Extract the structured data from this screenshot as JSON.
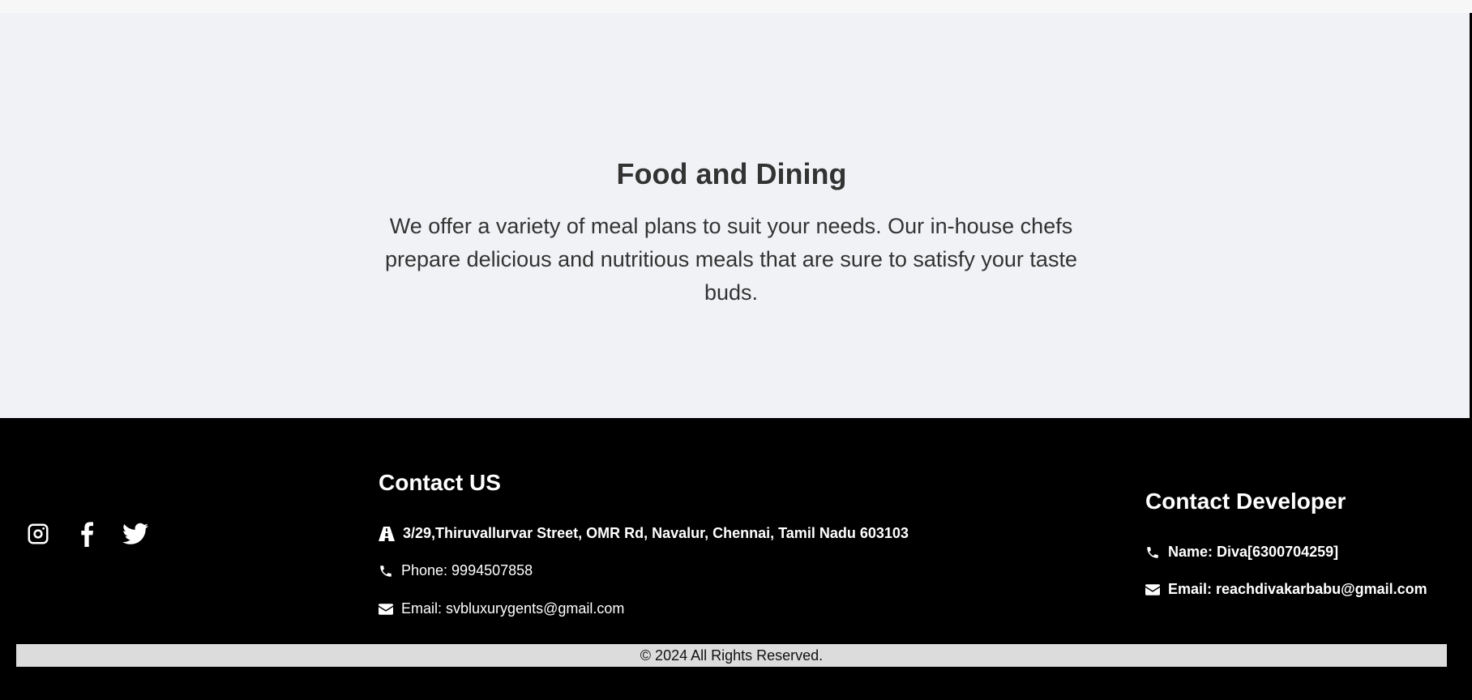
{
  "section": {
    "title": "Food and Dining",
    "text": "We offer a variety of meal plans to suit your needs. Our in-house chefs prepare delicious and nutritious meals that are sure to satisfy your taste buds."
  },
  "footer": {
    "social": [
      "instagram-icon",
      "facebook-icon",
      "twitter-icon"
    ],
    "contact_us": {
      "heading": "Contact US",
      "address": "3/29,Thiruvallurvar Street, OMR Rd, Navalur, Chennai, Tamil Nadu 603103",
      "phone": "Phone: 9994507858",
      "email": "Email: svbluxurygents@gmail.com"
    },
    "contact_developer": {
      "heading": "Contact Developer",
      "name": "Name: Diva[6300704259]",
      "email": "Email: reachdivakarbabu@gmail.com"
    },
    "copyright": "© 2024 All Rights Reserved."
  },
  "colors": {
    "section_bg": "#f0f2f5",
    "footer_bg": "#000000",
    "copyright_bg": "#dcdcdc",
    "text_dark": "#333333"
  }
}
